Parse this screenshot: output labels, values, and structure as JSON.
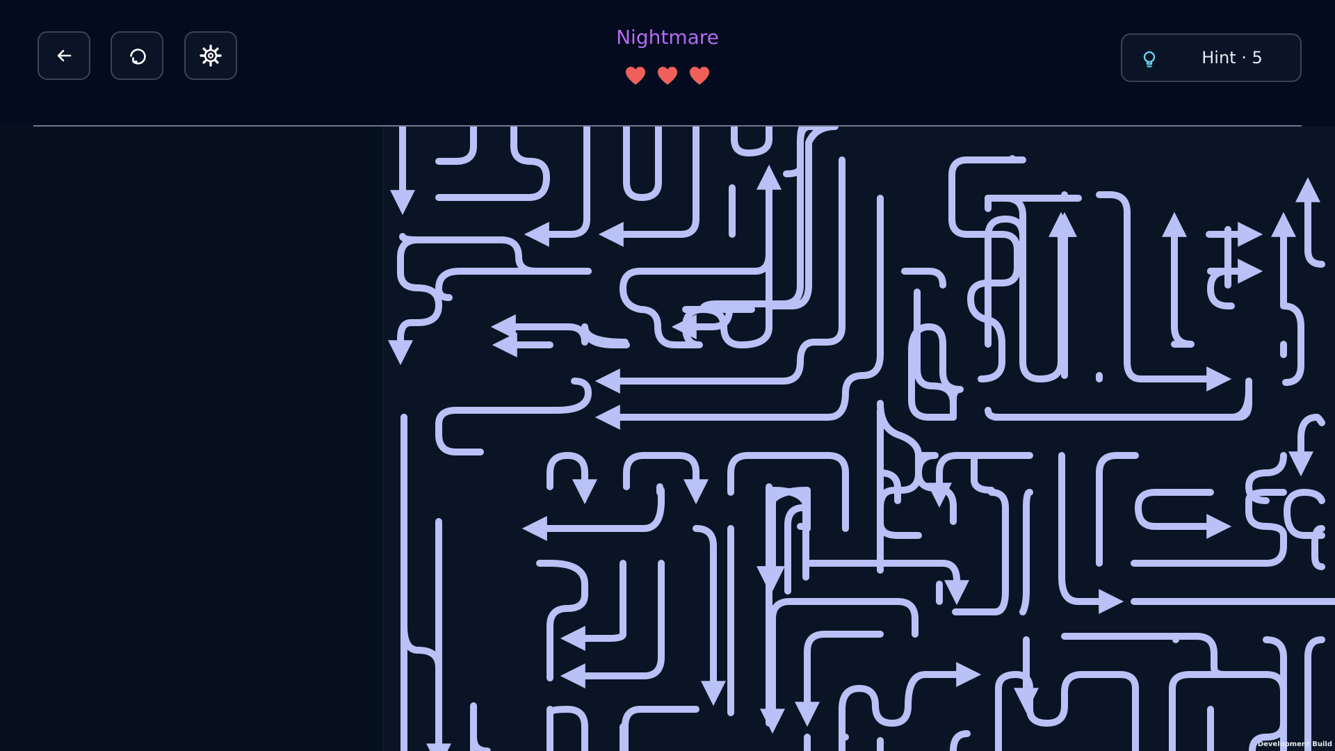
{
  "header": {
    "level_name": "Nightmare",
    "lives": 3,
    "hint_label": "Hint · 5"
  },
  "toolbar": {
    "back_icon": "arrow-left-icon",
    "restart_icon": "restart-icon",
    "settings_icon": "gear-icon"
  },
  "colors": {
    "background": "#060e1c",
    "title": "#b46bf2",
    "heart": "#f0605a",
    "path": "#b9c1f6",
    "hint_bulb": "#66d4ee"
  },
  "footer": {
    "build_tag": "Development Build"
  }
}
